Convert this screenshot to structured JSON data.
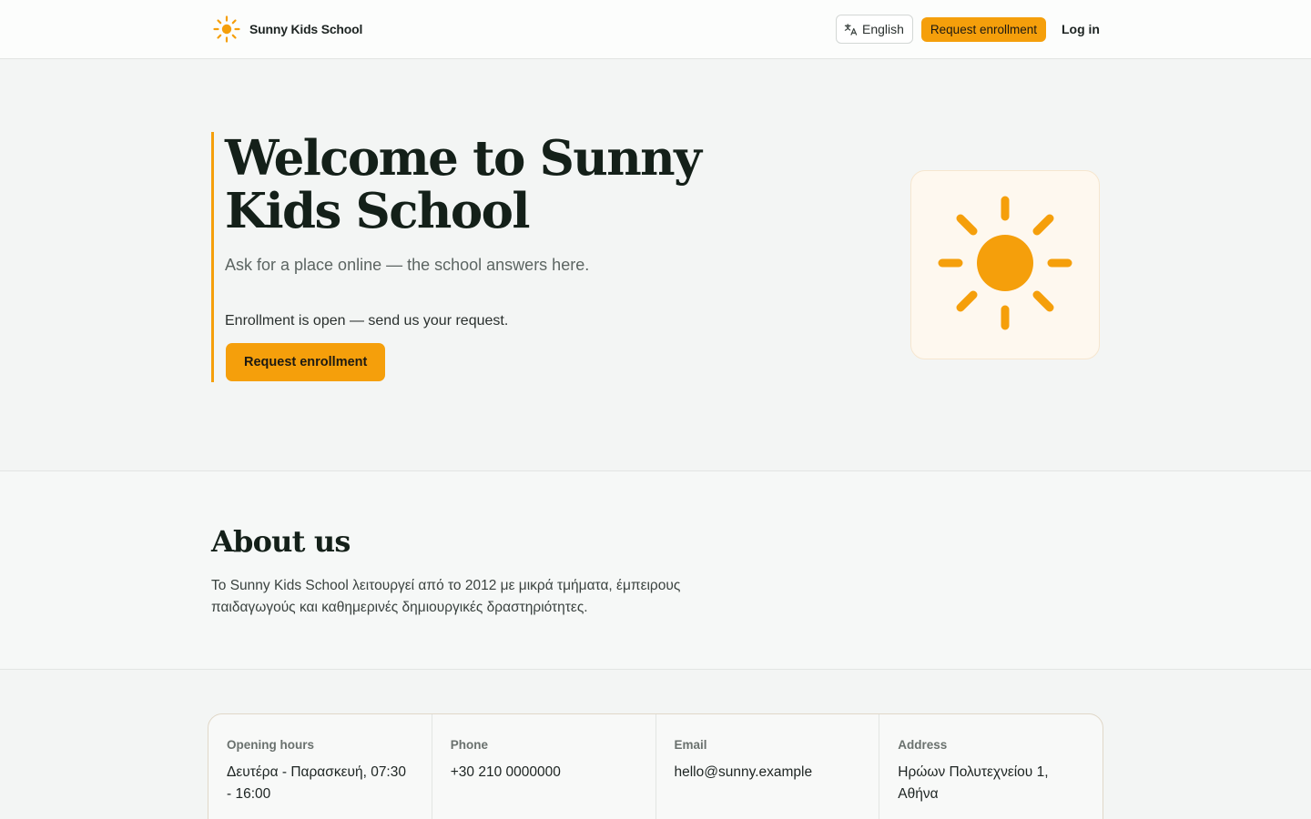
{
  "header": {
    "brand_name": "Sunny Kids School",
    "language_label": "English",
    "enroll_label": "Request enrollment",
    "login_label": "Log in"
  },
  "hero": {
    "title": "Welcome to Sunny Kids School",
    "subtitle": "Ask for a place online — the school answers here.",
    "status": "Enrollment is open — send us your request.",
    "cta_label": "Request enrollment"
  },
  "about": {
    "title": "About us",
    "text": "Το Sunny Kids School λειτουργεί από το 2012 με μικρά τμήματα, έμπειρους παιδαγωγούς και καθημερινές δημιουργικές δραστηριότητες."
  },
  "contact": [
    {
      "label": "Opening hours",
      "value": "Δευτέρα - Παρασκευή, 07:30 - 16:00"
    },
    {
      "label": "Phone",
      "value": "+30 210 0000000"
    },
    {
      "label": "Email",
      "value": "hello@sunny.example"
    },
    {
      "label": "Address",
      "value": "Ηρώων Πολυτεχνείου 1, Αθήνα"
    }
  ],
  "colors": {
    "accent": "#f59f0b",
    "background": "#f3f5f4",
    "text": "#1d2422"
  },
  "icons": {
    "brand": "sun-icon",
    "language": "translate-icon",
    "hero_art": "sun-icon"
  }
}
